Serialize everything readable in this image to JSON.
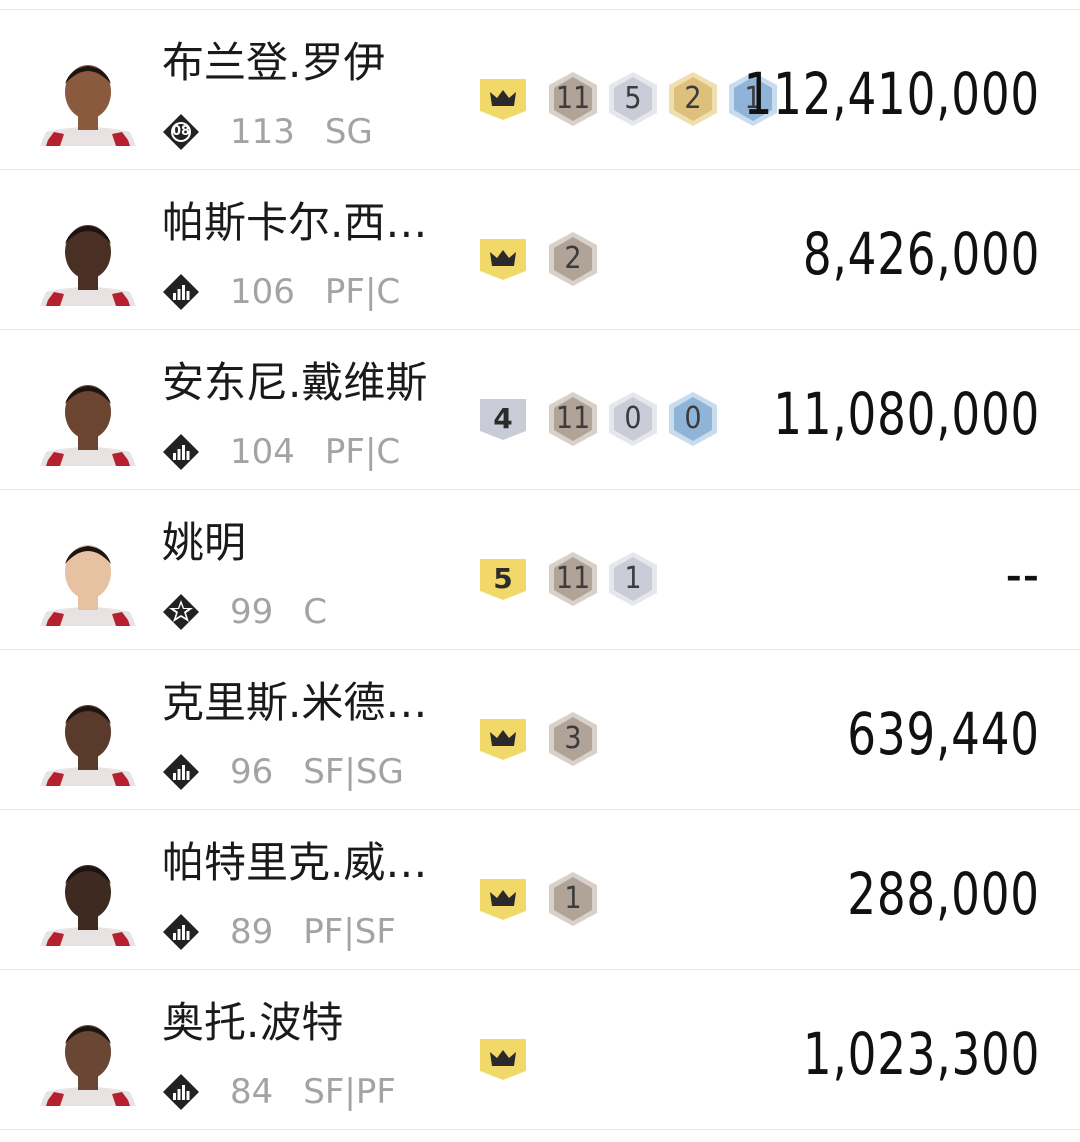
{
  "colors": {
    "crown_gold": "#f2d868",
    "badge_bronze": "#b0a397",
    "badge_silver": "#c9ccd6",
    "badge_gold": "#dcc07c",
    "badge_blue": "#8fb4d8",
    "text_gray": "#a3a3a3"
  },
  "players": [
    {
      "name": "布兰登.罗伊",
      "ovr": "113",
      "position": "SG",
      "tier_icon": "tier-08-icon",
      "tier_text": "08",
      "crown": true,
      "rank": "",
      "badges": [
        {
          "count": "11",
          "type": "bronze"
        },
        {
          "count": "5",
          "type": "silver"
        },
        {
          "count": "2",
          "type": "gold"
        },
        {
          "count": "1",
          "type": "blue"
        }
      ],
      "price": "112,410,000"
    },
    {
      "name": "帕斯卡尔.西…",
      "ovr": "106",
      "position": "PF|C",
      "tier_icon": "tier-bars-icon",
      "tier_text": "",
      "crown": true,
      "rank": "",
      "badges": [
        {
          "count": "2",
          "type": "bronze"
        }
      ],
      "price": "8,426,000"
    },
    {
      "name": "安东尼.戴维斯",
      "ovr": "104",
      "position": "PF|C",
      "tier_icon": "tier-bars-icon",
      "tier_text": "",
      "crown": false,
      "rank": "4",
      "rank_type": "silver",
      "badges": [
        {
          "count": "11",
          "type": "bronze"
        },
        {
          "count": "0",
          "type": "silver"
        },
        {
          "count": "0",
          "type": "blue"
        }
      ],
      "price": "11,080,000"
    },
    {
      "name": "姚明",
      "ovr": "99",
      "position": "C",
      "tier_icon": "tier-star-icon",
      "tier_text": "",
      "crown": false,
      "rank": "5",
      "rank_type": "gold",
      "badges": [
        {
          "count": "11",
          "type": "bronze"
        },
        {
          "count": "1",
          "type": "silver"
        }
      ],
      "price": "--"
    },
    {
      "name": "克里斯.米德…",
      "ovr": "96",
      "position": "SF|SG",
      "tier_icon": "tier-bars-icon",
      "tier_text": "",
      "crown": true,
      "rank": "",
      "badges": [
        {
          "count": "3",
          "type": "bronze"
        }
      ],
      "price": "639,440"
    },
    {
      "name": "帕特里克.威…",
      "ovr": "89",
      "position": "PF|SF",
      "tier_icon": "tier-bars-icon",
      "tier_text": "",
      "crown": true,
      "rank": "",
      "badges": [
        {
          "count": "1",
          "type": "bronze"
        }
      ],
      "price": "288,000"
    },
    {
      "name": "奥托.波特",
      "ovr": "84",
      "position": "SF|PF",
      "tier_icon": "tier-bars-icon",
      "tier_text": "",
      "crown": true,
      "rank": "",
      "badges": [],
      "price": "1,023,300"
    }
  ]
}
